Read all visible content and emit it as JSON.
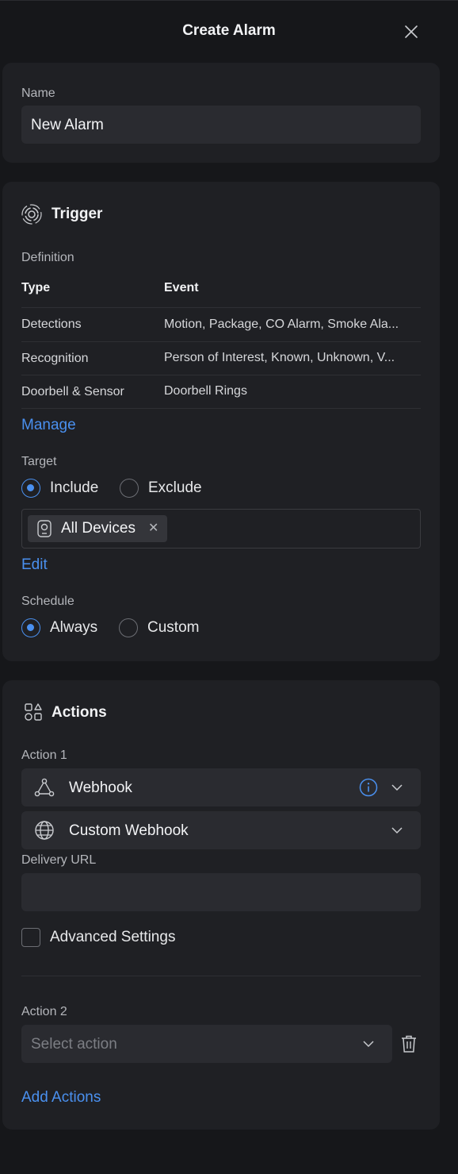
{
  "header": {
    "title": "Create Alarm"
  },
  "name_section": {
    "label": "Name",
    "value": "New Alarm"
  },
  "trigger": {
    "title": "Trigger",
    "definition_label": "Definition",
    "columns": [
      "Type",
      "Event"
    ],
    "rows": [
      {
        "type": "Detections",
        "event": "Motion, Package, CO Alarm, Smoke Ala..."
      },
      {
        "type": "Recognition",
        "event": "Person of Interest, Known, Unknown, V..."
      },
      {
        "type": "Doorbell & Sensor",
        "event": "Doorbell Rings"
      }
    ],
    "manage_label": "Manage",
    "target_label": "Target",
    "target_options": [
      "Include",
      "Exclude"
    ],
    "target_selected": "Include",
    "target_chip": "All Devices",
    "edit_label": "Edit",
    "schedule_label": "Schedule",
    "schedule_options": [
      "Always",
      "Custom"
    ],
    "schedule_selected": "Always"
  },
  "actions": {
    "title": "Actions",
    "action1_label": "Action 1",
    "action1_type": "Webhook",
    "action1_subtype": "Custom Webhook",
    "delivery_url_label": "Delivery URL",
    "delivery_url_value": "",
    "advanced_label": "Advanced Settings",
    "advanced_checked": false,
    "action2_label": "Action 2",
    "action2_placeholder": "Select action",
    "add_actions_label": "Add Actions"
  },
  "colors": {
    "accent": "#4a90ef",
    "background": "#16171a",
    "card": "#1f2024"
  }
}
